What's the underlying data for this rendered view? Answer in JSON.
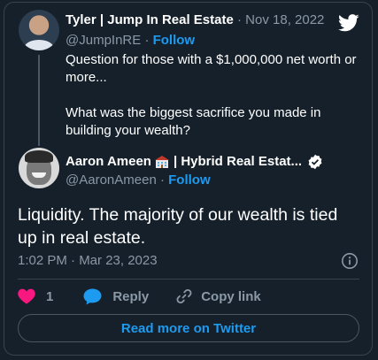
{
  "parent_tweet": {
    "display_name": "Tyler | Jump In Real Estate",
    "date": "· Nov 18, 2022",
    "handle": "@JumpInRE",
    "separator": "·",
    "follow_label": "Follow",
    "text_paragraphs": [
      "Question for those with a $1,000,000 net worth or more...",
      "What was the biggest sacrifice you made in building your wealth?"
    ]
  },
  "main_tweet": {
    "display_name_part1": "Aaron Ameen",
    "display_name_part2": "| Hybrid Real Estat...",
    "handle": "@AaronAmeen",
    "separator": "·",
    "follow_label": "Follow",
    "text": "Liquidity. The majority of our wealth is tied up in real estate.",
    "timestamp": "1:02 PM · Mar 23, 2023",
    "verified": true
  },
  "actions": {
    "like_count": "1",
    "reply_label": "Reply",
    "copy_link_label": "Copy link"
  },
  "read_more_label": "Read more on Twitter",
  "icons": {
    "logo": "twitter-bird-icon",
    "info": "info-icon",
    "like": "heart-icon",
    "reply": "speech-bubble-icon",
    "copy": "link-icon",
    "verified": "verified-badge-icon",
    "emoji": "building-emoji-icon"
  },
  "colors": {
    "background": "#15202b",
    "border": "#38444d",
    "accent": "#1d9bf0",
    "muted_text": "#8b98a5",
    "like": "#f91880",
    "text": "#ffffff"
  }
}
